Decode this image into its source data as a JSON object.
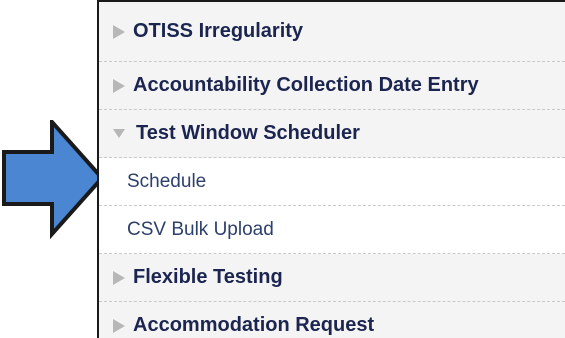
{
  "menu": {
    "items": [
      {
        "label": "OTISS Irregularity",
        "expanded": false
      },
      {
        "label": "Accountability Collection Date Entry",
        "expanded": false
      },
      {
        "label": "Test Window Scheduler",
        "expanded": true
      },
      {
        "label": "Schedule"
      },
      {
        "label": "CSV Bulk Upload"
      },
      {
        "label": "Flexible Testing",
        "expanded": false
      },
      {
        "label": "Accommodation Request",
        "expanded": false
      }
    ]
  },
  "annotation": {
    "arrow_color": "#4a86d2",
    "arrow_icon": "right-arrow-icon",
    "points_to": "Schedule"
  },
  "colors": {
    "section_text": "#1b2550",
    "link_text": "#2d3f6b",
    "section_bg": "#f4f4f4",
    "triangle": "#b7b7b7"
  }
}
